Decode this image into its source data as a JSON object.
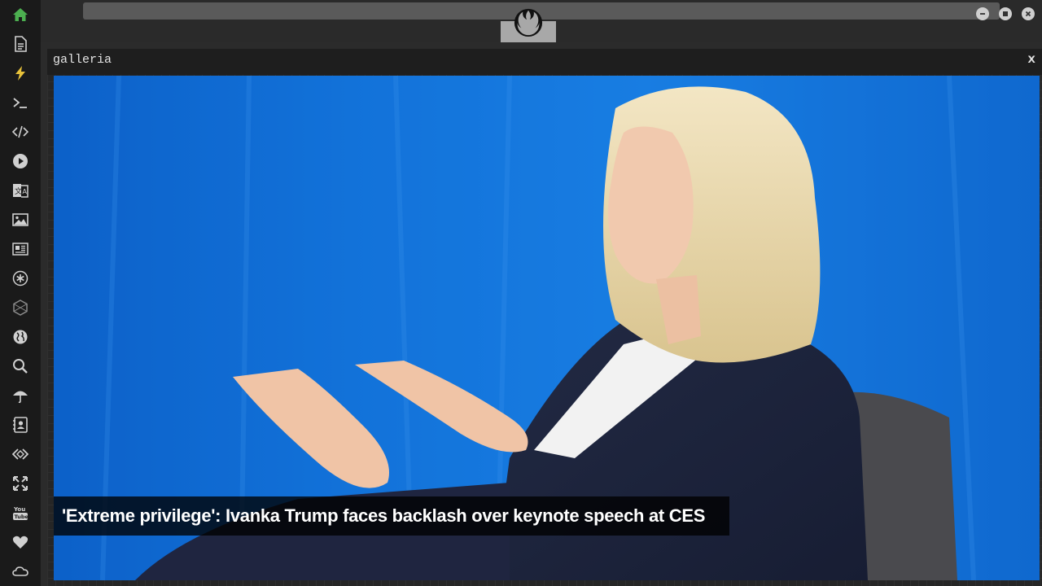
{
  "gallery": {
    "title": "galleria",
    "close_label": "x",
    "caption": "'Extreme privilege': Ivanka Trump faces backlash over keynote speech at CES"
  },
  "sidebar": {
    "items": [
      {
        "icon": "home-icon"
      },
      {
        "icon": "document-icon"
      },
      {
        "icon": "lightning-icon"
      },
      {
        "icon": "terminal-icon"
      },
      {
        "icon": "code-icon"
      },
      {
        "icon": "play-icon"
      },
      {
        "icon": "translate-icon"
      },
      {
        "icon": "image-icon"
      },
      {
        "icon": "news-icon"
      },
      {
        "icon": "asterisk-icon"
      },
      {
        "icon": "hexagon-icon"
      },
      {
        "icon": "globe-icon"
      },
      {
        "icon": "search-icon"
      },
      {
        "icon": "umbrella-icon"
      },
      {
        "icon": "contacts-icon"
      },
      {
        "icon": "api-icon"
      },
      {
        "icon": "expand-icon"
      },
      {
        "icon": "youtube-icon"
      },
      {
        "icon": "heart-icon"
      },
      {
        "icon": "cloud-icon"
      }
    ]
  },
  "colors": {
    "sidebar_bg": "#1a1a1a",
    "active_icon": "#4caf50",
    "icon": "#d0d0d0",
    "panel_bg": "#262626"
  }
}
